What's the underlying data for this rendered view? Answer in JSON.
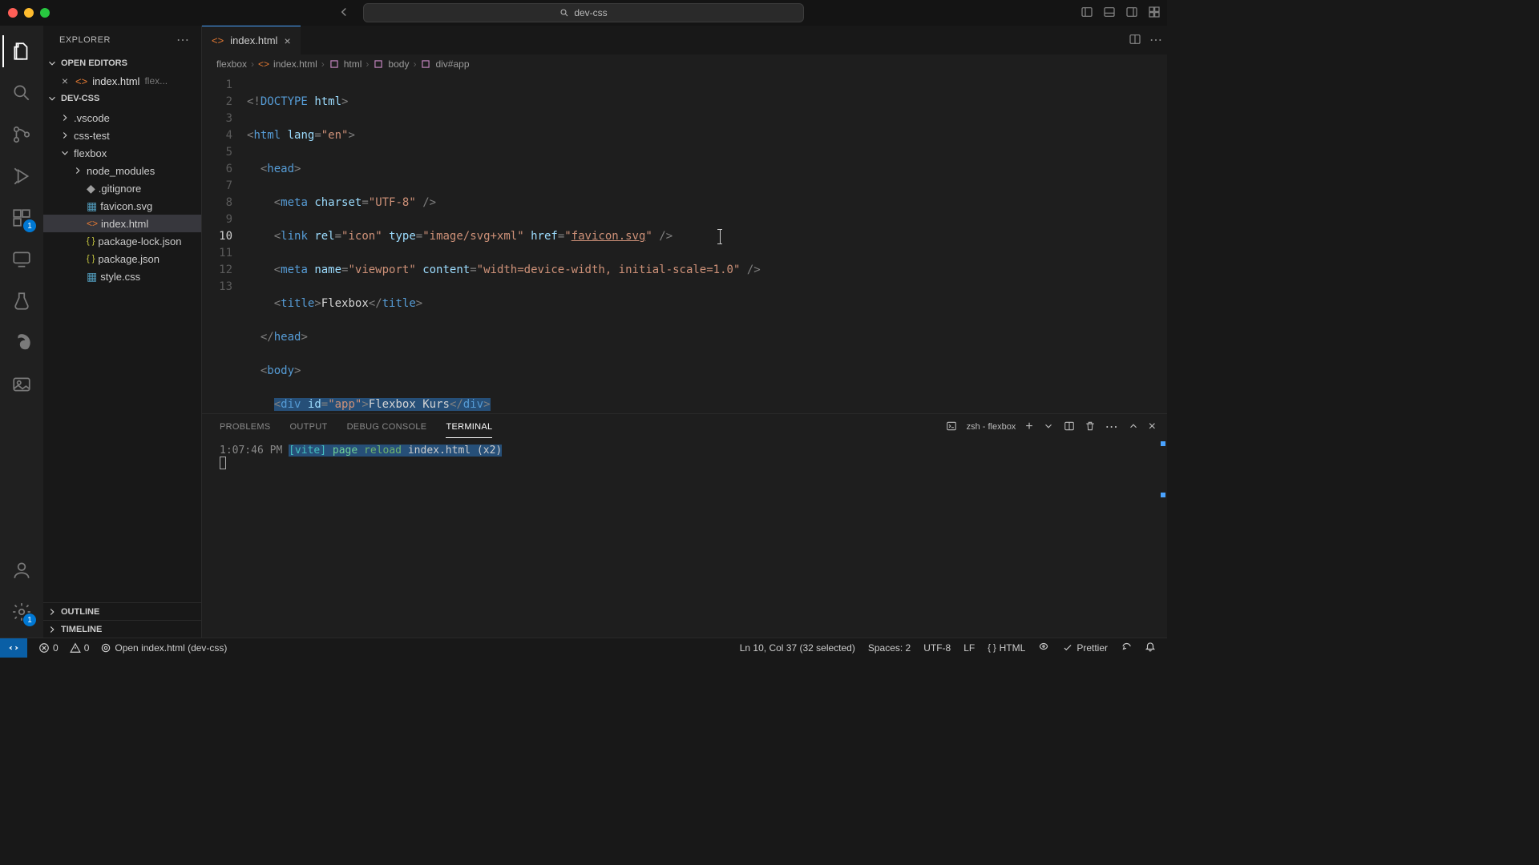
{
  "title_search": "dev-css",
  "sidebar": {
    "title": "EXPLORER",
    "open_editors_label": "OPEN EDITORS",
    "open_editor": {
      "name": "index.html",
      "desc": "flex..."
    },
    "root": "DEV-CSS",
    "tree": [
      {
        "label": ".vscode",
        "kind": "folder",
        "indent": 1,
        "chev": "right"
      },
      {
        "label": "css-test",
        "kind": "folder",
        "indent": 1,
        "chev": "right"
      },
      {
        "label": "flexbox",
        "kind": "folder",
        "indent": 1,
        "chev": "down"
      },
      {
        "label": "node_modules",
        "kind": "folder",
        "indent": 2,
        "chev": "right"
      },
      {
        "label": ".gitignore",
        "kind": "file-gray",
        "indent": 2
      },
      {
        "label": "favicon.svg",
        "kind": "file-blue",
        "indent": 2
      },
      {
        "label": "index.html",
        "kind": "file-orange",
        "indent": 2,
        "selected": true
      },
      {
        "label": "package-lock.json",
        "kind": "file-yellow",
        "indent": 2
      },
      {
        "label": "package.json",
        "kind": "file-yellow",
        "indent": 2
      },
      {
        "label": "style.css",
        "kind": "file-blue",
        "indent": 2
      }
    ],
    "outline_label": "OUTLINE",
    "timeline_label": "TIMELINE"
  },
  "tab": {
    "name": "index.html"
  },
  "breadcrumb": [
    "flexbox",
    "index.html",
    "html",
    "body",
    "div#app"
  ],
  "code_lines": 13,
  "active_line": 10,
  "panel": {
    "tabs": [
      "PROBLEMS",
      "OUTPUT",
      "DEBUG CONSOLE",
      "TERMINAL"
    ],
    "active": 3,
    "shell": "zsh - flexbox",
    "time": "1:07:46 PM",
    "vite": "[vite]",
    "page": "page",
    "reload": "reload",
    "msg": "index.html (x2)"
  },
  "status": {
    "errors": "0",
    "warnings": "0",
    "open_file": "Open index.html (dev-css)",
    "position": "Ln 10, Col 37 (32 selected)",
    "spaces": "Spaces: 2",
    "encoding": "UTF-8",
    "eol": "LF",
    "lang": "HTML",
    "prettier": "Prettier"
  },
  "badges": {
    "ext": "1",
    "settings": "1"
  }
}
